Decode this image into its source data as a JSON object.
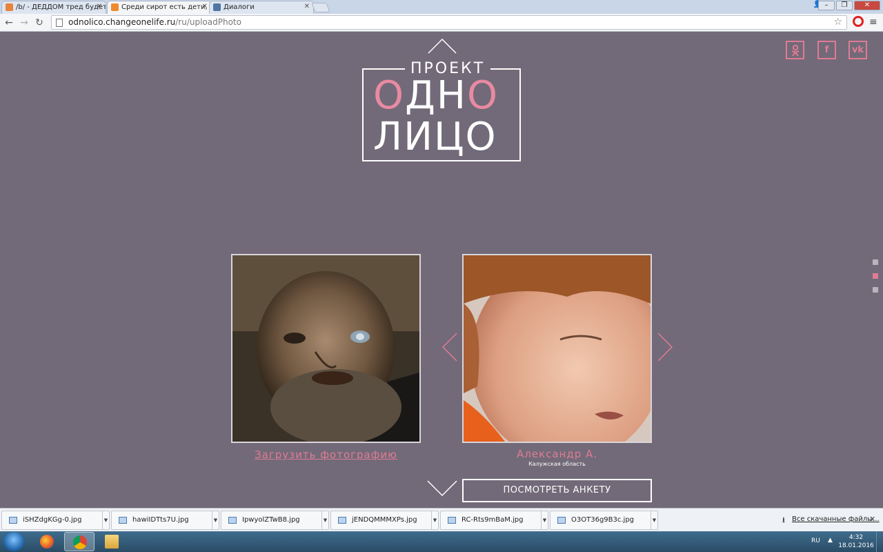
{
  "browser": {
    "tabs": [
      {
        "title": "/b/ - ДЕДДОМ тред будет",
        "icon_color": "#e8833a"
      },
      {
        "title": "Среди сирот есть дети, п",
        "icon_color": "#f08a30"
      },
      {
        "title": "Диалоги",
        "icon_color": "#4d76a3"
      }
    ],
    "url_host": "odnolico.changeonelife.ru",
    "url_path": "/ru/uploadPhoto"
  },
  "page": {
    "logo_top": "ПРОЕКТ",
    "logo_line1_a": "О",
    "logo_line1_b": "ДН",
    "logo_line1_c": "О",
    "logo_line2": "ЛИЦО",
    "social": [
      {
        "name": "ok",
        "label": "ok"
      },
      {
        "name": "facebook",
        "label": "f"
      },
      {
        "name": "vk",
        "label": "vk"
      }
    ],
    "upload_label": "Загрузить фотографию",
    "child_name": "Александр А.",
    "child_region": "Калужская область",
    "profile_button": "ПОСМОТРЕТЬ АНКЕТУ",
    "accent_color": "#e07b94",
    "background_color": "#726a78"
  },
  "downloads": {
    "files": [
      "iSHZdgKGg-0.jpg",
      "hawiIDTts7U.jpg",
      "IpwyolZTwB8.jpg",
      "jENDQMMMXPs.jpg",
      "RC-Rts9mBaM.jpg",
      "O3OT36g9B3c.jpg"
    ],
    "all_label": "Все скачанные файлы..."
  },
  "taskbar": {
    "lang": "RU",
    "time": "4:32",
    "date": "18.01.2016"
  }
}
